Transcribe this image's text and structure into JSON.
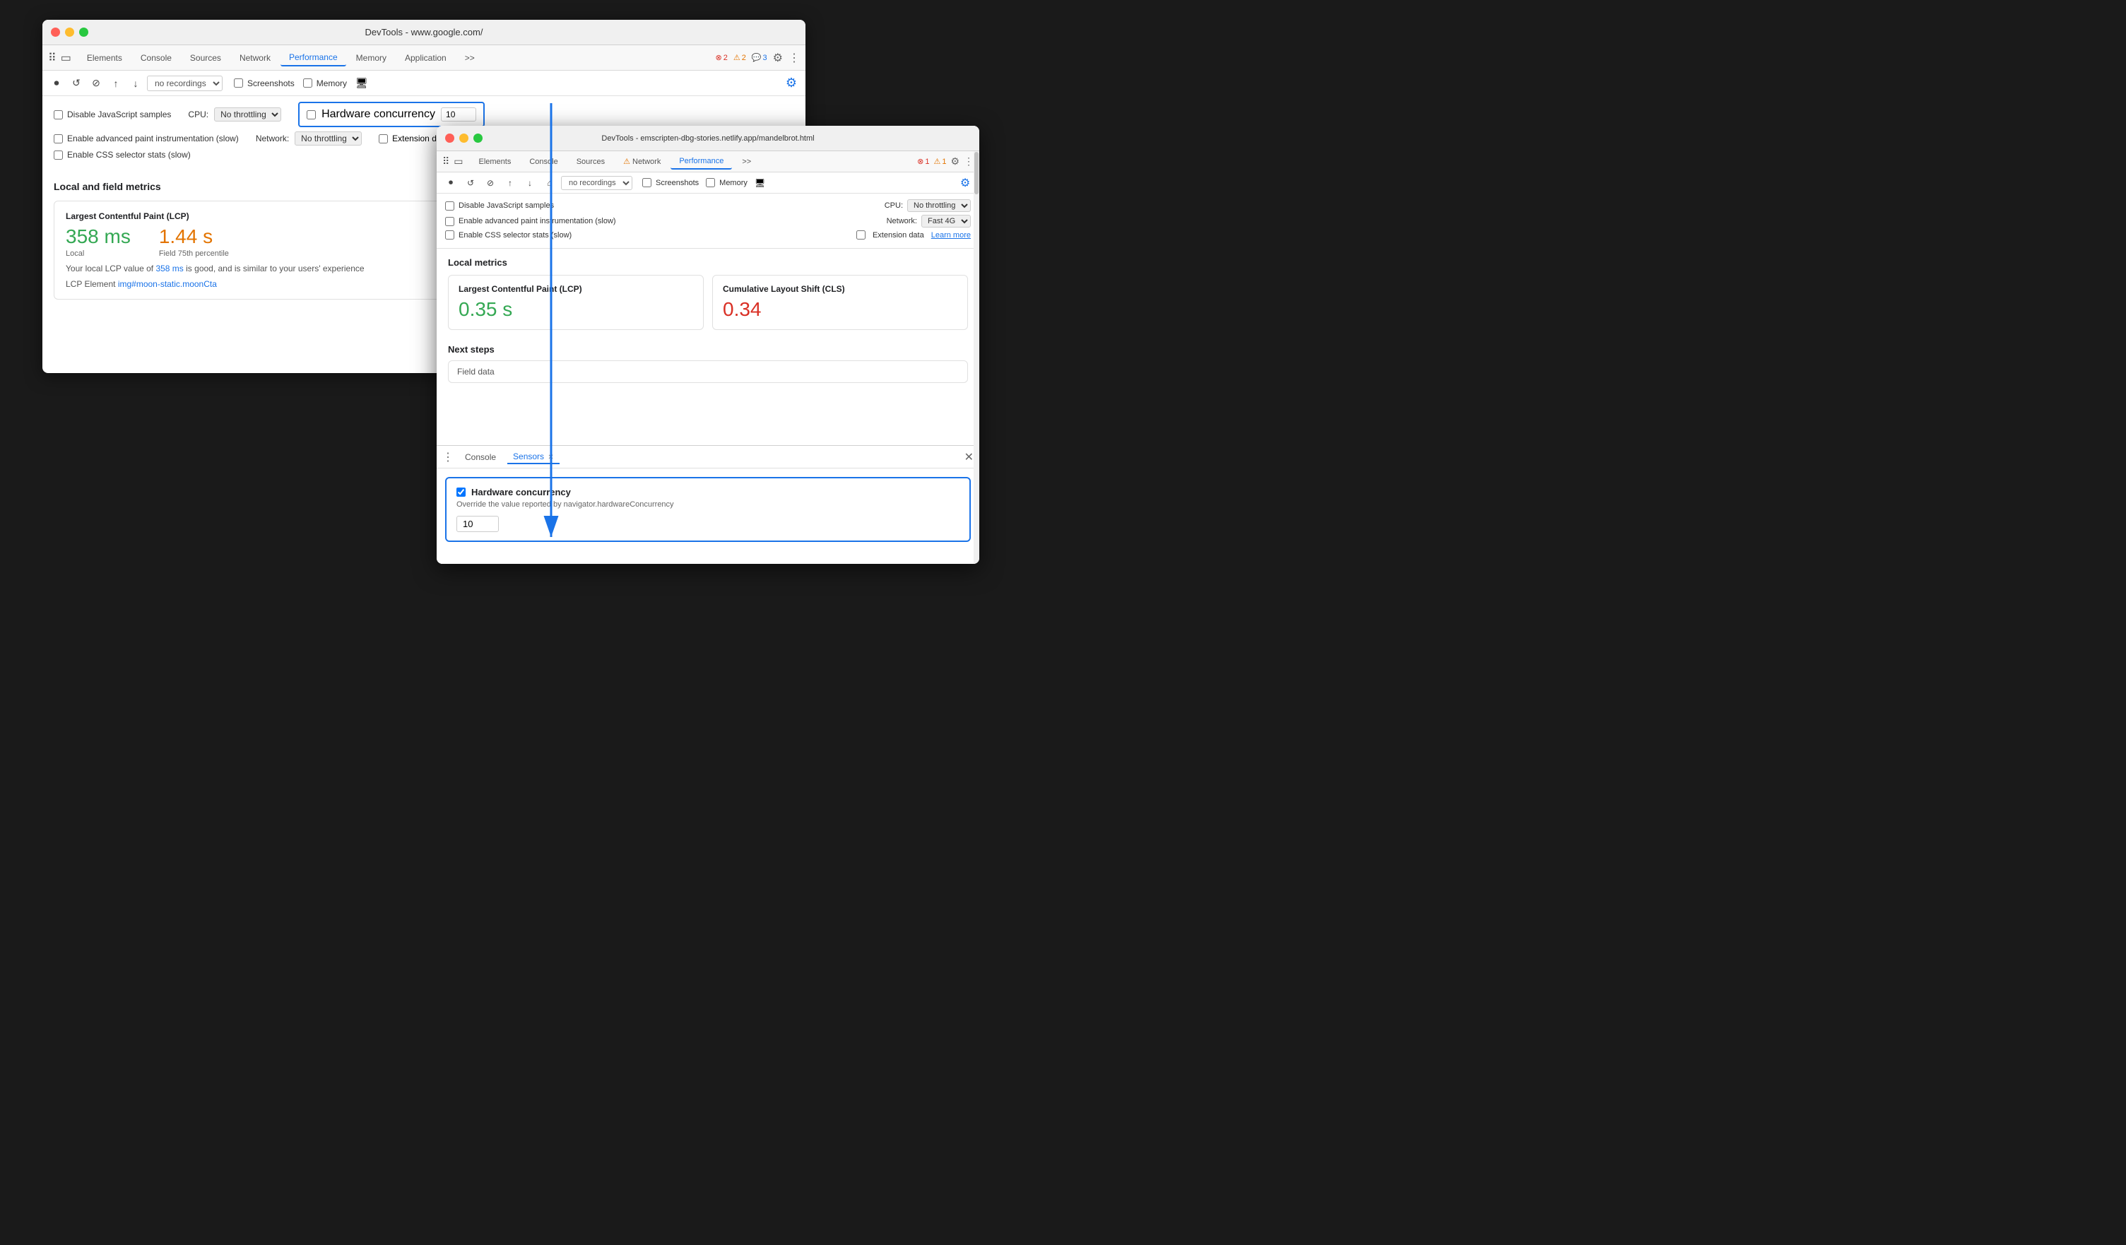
{
  "background_color": "#1a1a1a",
  "back_window": {
    "title": "DevTools - www.google.com/",
    "traffic_lights": [
      "red",
      "yellow",
      "green"
    ],
    "tabs": [
      {
        "label": "Elements",
        "active": false
      },
      {
        "label": "Console",
        "active": false
      },
      {
        "label": "Sources",
        "active": false
      },
      {
        "label": "Network",
        "active": false
      },
      {
        "label": "Performance",
        "active": true
      },
      {
        "label": "Memory",
        "active": false
      },
      {
        "label": "Application",
        "active": false
      },
      {
        "label": ">>",
        "active": false
      }
    ],
    "badges": {
      "errors": "2",
      "warnings": "2",
      "info": "3"
    },
    "toolbar": {
      "recordings_placeholder": "no recordings",
      "screenshots_label": "Screenshots",
      "memory_label": "Memory"
    },
    "options": {
      "disable_js_samples": "Disable JavaScript samples",
      "enable_advanced_paint": "Enable advanced paint instrumentation (slow)",
      "enable_css_selector": "Enable CSS selector stats (slow)",
      "cpu_label": "CPU:",
      "cpu_value": "No throttling",
      "network_label": "Network:",
      "network_value": "No throttling",
      "hw_concurrency_label": "Hardware concurrency",
      "hw_concurrency_value": "10",
      "extension_data_label": "Extension data"
    },
    "metrics": {
      "section_title": "Local and field metrics",
      "lcp_label": "Largest Contentful Paint (LCP)",
      "lcp_local": "358 ms",
      "lcp_local_sub": "Local",
      "lcp_field": "1.44 s",
      "lcp_field_sub": "Field 75th percentile",
      "lcp_desc": "Your local LCP value of",
      "lcp_value_inline": "358 ms",
      "lcp_desc2": "is good, and is similar to your users' experience",
      "lcp_element_label": "LCP Element",
      "lcp_element_value": "img#moon-static.moonCta"
    }
  },
  "front_window": {
    "title": "DevTools - emscripten-dbg-stories.netlify.app/mandelbrot.html",
    "traffic_lights": [
      "red",
      "yellow",
      "green"
    ],
    "tabs": [
      {
        "label": "Elements",
        "active": false
      },
      {
        "label": "Console",
        "active": false
      },
      {
        "label": "Sources",
        "active": false
      },
      {
        "label": "Network",
        "active": false,
        "has_warning": true
      },
      {
        "label": "Performance",
        "active": true
      },
      {
        "label": ">>",
        "active": false
      }
    ],
    "badges": {
      "errors": "1",
      "warnings": "1"
    },
    "options": {
      "disable_js_samples": "Disable JavaScript samples",
      "enable_advanced_paint": "Enable advanced paint instrumentation (slow)",
      "enable_css_selector": "Enable CSS selector stats (slow)",
      "cpu_label": "CPU:",
      "cpu_value": "No throttling",
      "network_label": "Network:",
      "network_value": "Fast 4G",
      "extension_data_label": "Extension data",
      "learn_more_label": "Learn more"
    },
    "local_metrics": {
      "title": "Local metrics",
      "lcp_label": "Largest Contentful Paint (LCP)",
      "lcp_value": "0.35 s",
      "cls_label": "Cumulative Layout Shift (CLS)",
      "cls_value": "0.34"
    },
    "next_steps": {
      "title": "Next steps",
      "field_data_label": "Field data"
    },
    "drawer": {
      "tabs": [
        {
          "label": "Console",
          "active": false
        },
        {
          "label": "Sensors",
          "active": true
        }
      ],
      "hw_concurrency": {
        "checked": true,
        "title": "Hardware concurrency",
        "desc": "Override the value reported by navigator.hardwareConcurrency",
        "value": "10"
      }
    }
  },
  "arrow": {
    "color": "#1a73e8",
    "description": "Arrow pointing from Hardware concurrency checkbox to drawer panel"
  }
}
